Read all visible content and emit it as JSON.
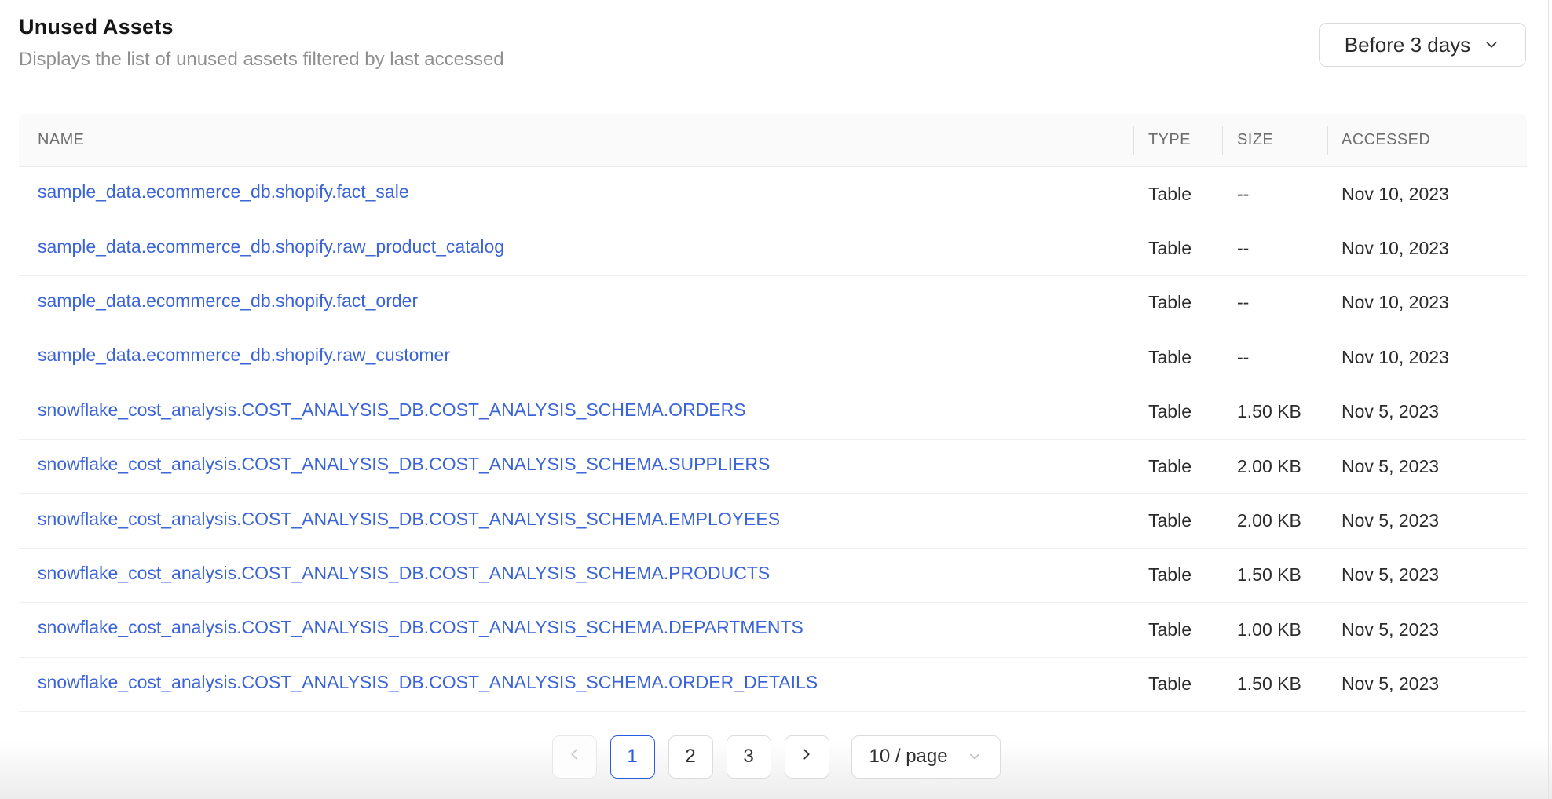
{
  "page": {
    "title": "Unused Assets",
    "subtitle": "Displays the list of unused assets filtered by last accessed"
  },
  "filter": {
    "selected_value": "Before 3 days",
    "icon": "chevron-down-icon"
  },
  "table": {
    "columns": [
      "NAME",
      "TYPE",
      "SIZE",
      "ACCESSED"
    ],
    "rows": [
      {
        "name": "sample_data.ecommerce_db.shopify.fact_sale",
        "type": "Table",
        "size": "--",
        "accessed": "Nov 10, 2023"
      },
      {
        "name": "sample_data.ecommerce_db.shopify.raw_product_catalog",
        "type": "Table",
        "size": "--",
        "accessed": "Nov 10, 2023"
      },
      {
        "name": "sample_data.ecommerce_db.shopify.fact_order",
        "type": "Table",
        "size": "--",
        "accessed": "Nov 10, 2023"
      },
      {
        "name": "sample_data.ecommerce_db.shopify.raw_customer",
        "type": "Table",
        "size": "--",
        "accessed": "Nov 10, 2023"
      },
      {
        "name": "snowflake_cost_analysis.COST_ANALYSIS_DB.COST_ANALYSIS_SCHEMA.ORDERS",
        "type": "Table",
        "size": "1.50 KB",
        "accessed": "Nov 5, 2023"
      },
      {
        "name": "snowflake_cost_analysis.COST_ANALYSIS_DB.COST_ANALYSIS_SCHEMA.SUPPLIERS",
        "type": "Table",
        "size": "2.00 KB",
        "accessed": "Nov 5, 2023"
      },
      {
        "name": "snowflake_cost_analysis.COST_ANALYSIS_DB.COST_ANALYSIS_SCHEMA.EMPLOYEES",
        "type": "Table",
        "size": "2.00 KB",
        "accessed": "Nov 5, 2023"
      },
      {
        "name": "snowflake_cost_analysis.COST_ANALYSIS_DB.COST_ANALYSIS_SCHEMA.PRODUCTS",
        "type": "Table",
        "size": "1.50 KB",
        "accessed": "Nov 5, 2023"
      },
      {
        "name": "snowflake_cost_analysis.COST_ANALYSIS_DB.COST_ANALYSIS_SCHEMA.DEPARTMENTS",
        "type": "Table",
        "size": "1.00 KB",
        "accessed": "Nov 5, 2023"
      },
      {
        "name": "snowflake_cost_analysis.COST_ANALYSIS_DB.COST_ANALYSIS_SCHEMA.ORDER_DETAILS",
        "type": "Table",
        "size": "1.50 KB",
        "accessed": "Nov 5, 2023"
      }
    ]
  },
  "pagination": {
    "prev_icon": "chevron-left-icon",
    "next_icon": "chevron-right-icon",
    "pages": [
      "1",
      "2",
      "3"
    ],
    "active_page": "1",
    "page_size_label": "10 / page",
    "page_size_icon": "chevron-down-icon"
  },
  "colors": {
    "link_blue": "#3a64d8",
    "active_pagination_blue": "#2b5ce0",
    "header_bg": "#fafafa",
    "row_border": "#f0f0f0",
    "control_border": "#dcdcdc",
    "muted_text": "#8f8f8f"
  }
}
